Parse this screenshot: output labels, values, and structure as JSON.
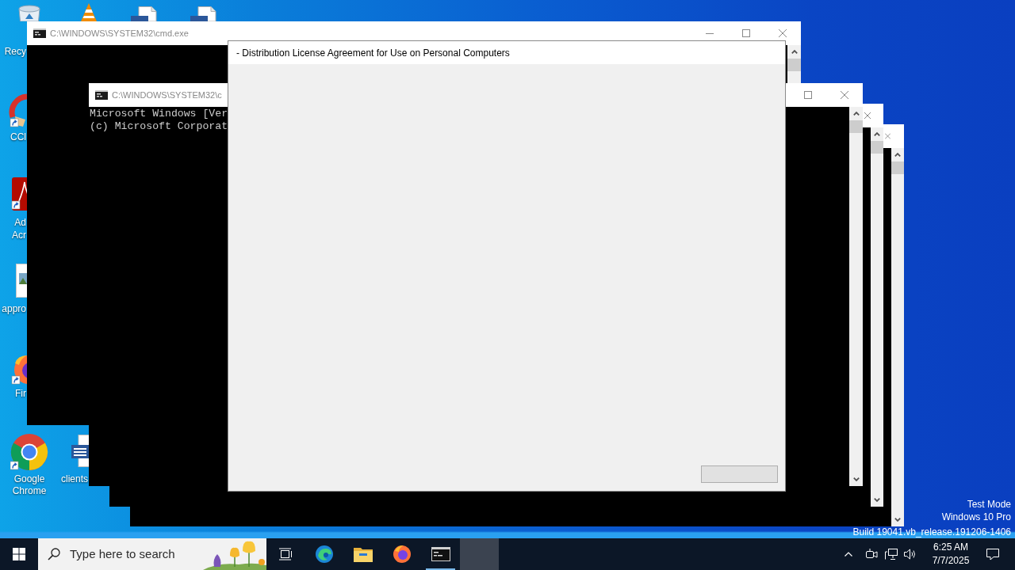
{
  "desktop_icons": [
    {
      "label_lines": [
        "Recy"
      ]
    },
    {
      "label_lines": [
        "CCl"
      ]
    },
    {
      "label_lines": [
        "Ad",
        "Acr"
      ]
    },
    {
      "label_lines": [
        "appro"
      ]
    },
    {
      "label_lines": [
        "Fir"
      ]
    },
    {
      "label_lines": [
        "Google",
        "Chrome"
      ]
    },
    {
      "label_lines": [
        "clients"
      ]
    }
  ],
  "desktop_info": [
    "Test Mode",
    "Windows 10 Pro",
    "Build 19041.vb_release.191206-1406"
  ],
  "windows": [
    {
      "title": "C:\\WINDOWS\\SYSTEM32\\cmd.exe",
      "active": false
    },
    {
      "title": "C:\\WINDOWS\\SYSTEM32\\c",
      "active": false,
      "console_lines": [
        "Microsoft Windows [Ver",
        "(c) Microsoft Corporat"
      ]
    },
    {
      "active": false
    },
    {
      "active": false
    }
  ],
  "dialog": {
    "title": "- Distribution License Agreement for Use on Personal Computers",
    "active": true
  },
  "taskbar": {
    "search": {
      "placeholder": "Type here to search"
    },
    "apps": [
      {
        "running": false,
        "selected": false
      },
      {
        "running": false,
        "selected": false
      },
      {
        "running": false,
        "selected": false
      },
      {
        "running": true,
        "selected": false
      },
      {
        "running": false,
        "selected": true
      }
    ],
    "clock": {
      "time": "6:25 AM",
      "date": "7/7/2025"
    }
  }
}
